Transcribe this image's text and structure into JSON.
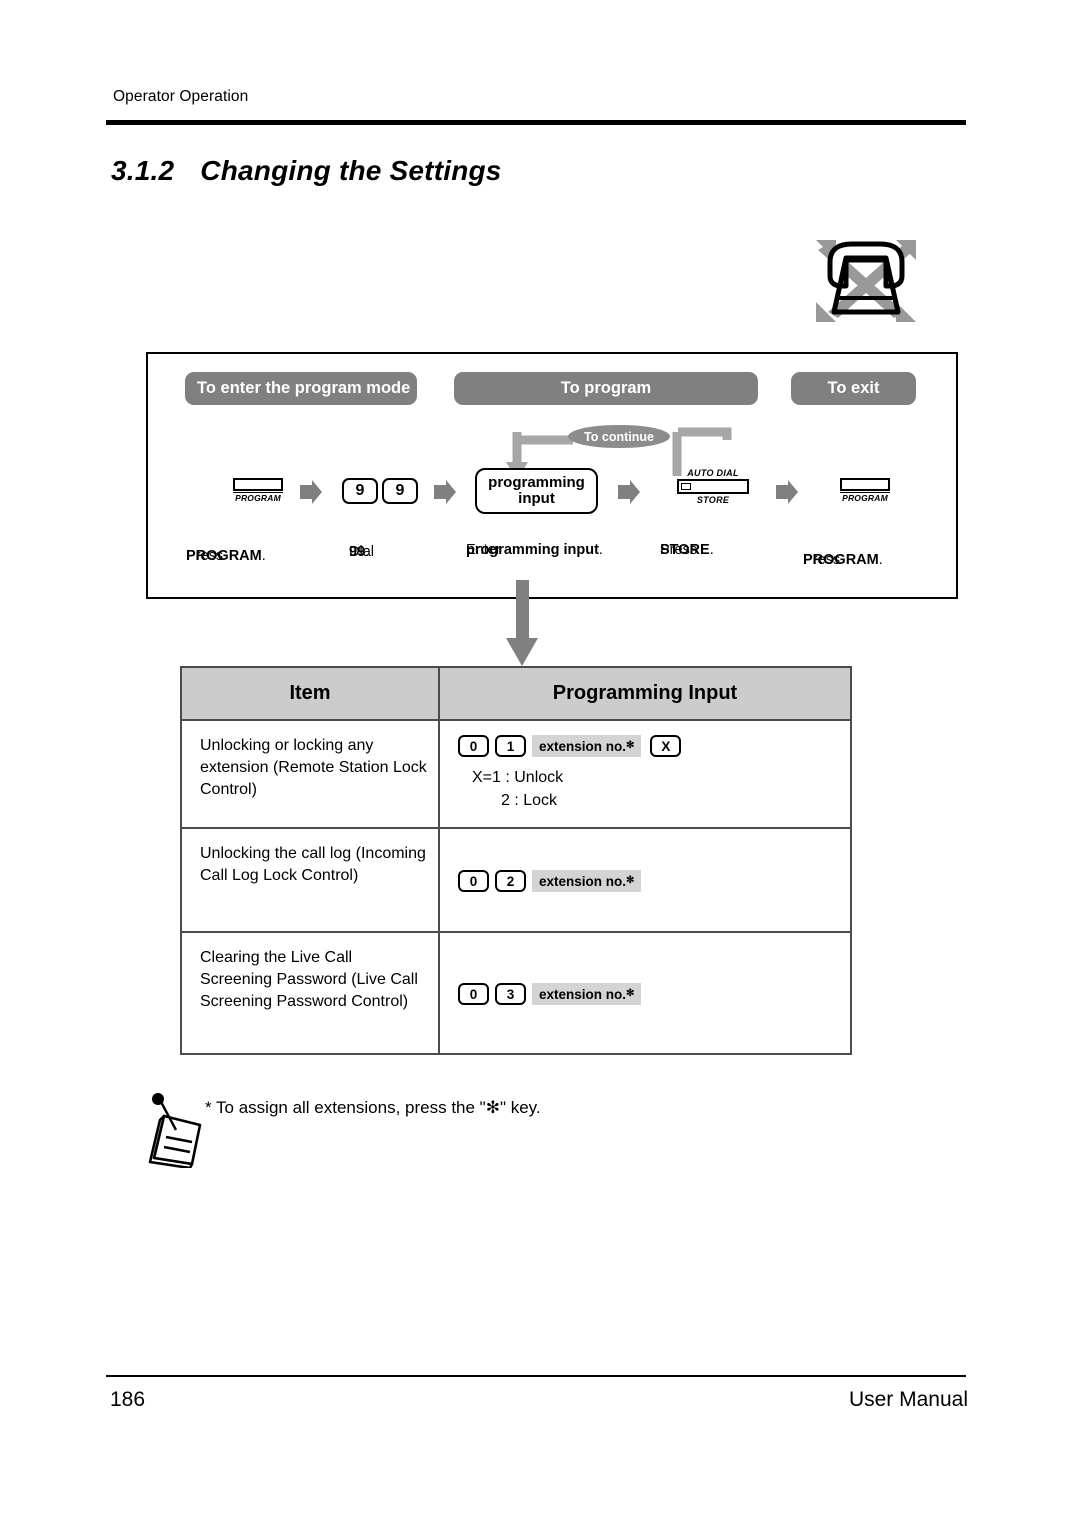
{
  "page": {
    "running_header": "Operator Operation",
    "section_number": "3.1.2",
    "section_title": "Changing the Settings",
    "footer_page_number": "186",
    "footer_title": "User Manual"
  },
  "icons": {
    "phone": "crossed-out-proprietary-telephone-icon",
    "note": "note-memo-icon"
  },
  "flow": {
    "phases": [
      {
        "label": "To enter the program mode"
      },
      {
        "label": "To program"
      },
      {
        "label": "To exit"
      }
    ],
    "loop_label": "To continue",
    "steps": [
      {
        "key_type": "program-key",
        "key_label": "PROGRAM",
        "caption": "Press PROGRAM."
      },
      {
        "key_type": "digit-keys",
        "digits": [
          "9",
          "9"
        ],
        "caption": "Dial 99."
      },
      {
        "key_type": "input-box",
        "line1": "programming",
        "line2": "input",
        "caption": "Enter programming input."
      },
      {
        "key_type": "store-key",
        "top_label": "AUTO DIAL",
        "bottom_label": "STORE",
        "caption": "Press STORE."
      },
      {
        "key_type": "program-key",
        "key_label": "PROGRAM",
        "caption": "Press PROGRAM."
      }
    ],
    "captions": {
      "c1_pre": "Press ",
      "c1_bold": "PROGRAM",
      "c1_post": ".",
      "c2_pre": "Dial ",
      "c2_bold": "99",
      "c2_post": ".",
      "c3_pre": "Enter ",
      "c3_bold": "programming input",
      "c3_post": ".",
      "c4_pre": "Press ",
      "c4_bold": "STORE",
      "c4_post": ".",
      "c5_pre": "Press ",
      "c5_bold": "PROGRAM",
      "c5_post": "."
    }
  },
  "table": {
    "headers": {
      "item": "Item",
      "programming_input": "Programming Input"
    },
    "rows": [
      {
        "item": "Unlocking or locking any extension (Remote Station Lock Control)",
        "keys": [
          "0",
          "1"
        ],
        "chip": "extension no.",
        "chip_mark": "✻",
        "extra_key": "X",
        "values": [
          "X=1 : Unlock",
          "2 : Lock"
        ]
      },
      {
        "item": "Unlocking the call log (Incoming Call Log Lock Control)",
        "keys": [
          "0",
          "2"
        ],
        "chip": "extension no.",
        "chip_mark": "✻",
        "extra_key": null,
        "values": []
      },
      {
        "item": "Clearing the Live Call Screening Password (Live Call Screening Password Control)",
        "keys": [
          "0",
          "3"
        ],
        "chip": "extension no.",
        "chip_mark": "✻",
        "extra_key": null,
        "values": []
      }
    ]
  },
  "note": {
    "text": "* To assign all extensions, press the \"✻\" key."
  },
  "colors": {
    "phase_bar_gray": "#808080",
    "table_header_gray": "#cccccc",
    "chip_gray": "#d4d4d4",
    "arrow_gray": "#808080",
    "rule_black": "#000000"
  }
}
